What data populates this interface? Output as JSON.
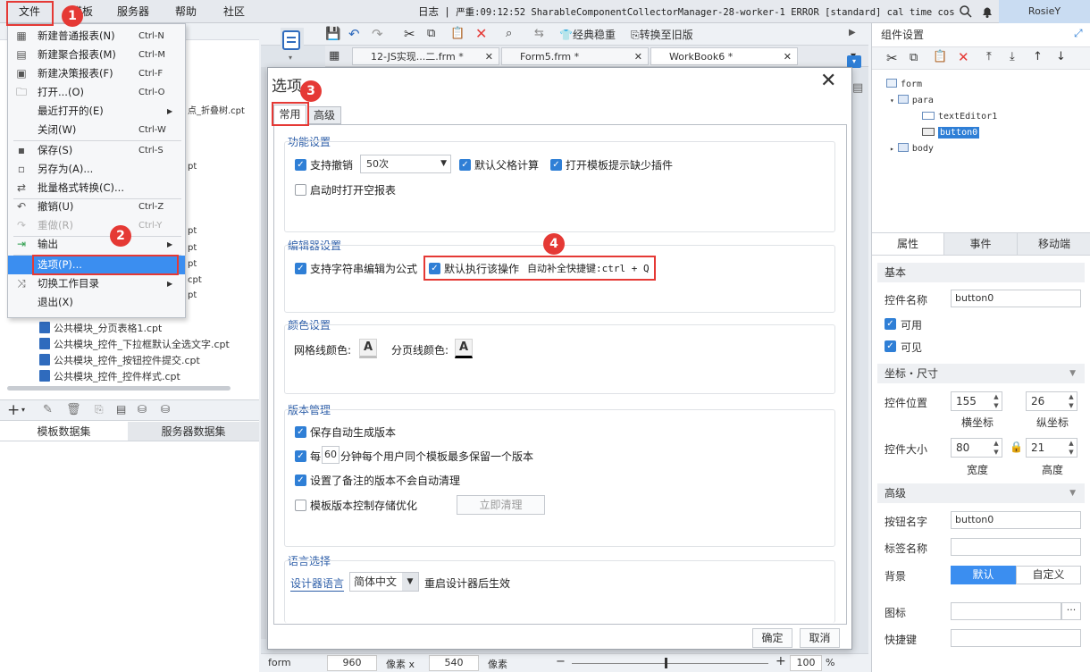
{
  "menubar": {
    "items": [
      "文件",
      "模板",
      "服务器",
      "帮助",
      "社区"
    ],
    "log_label": "日志",
    "log_message": "严重:09:12:52 SharableComponentCollectorManager-28-worker-1 ERROR [standard] cal time cost...",
    "user": "RosieY"
  },
  "file_menu": {
    "items": [
      {
        "icon": "new-report-icon",
        "label": "新建普通报表(N)",
        "shortcut": "Ctrl-N"
      },
      {
        "icon": "new-aggregate-icon",
        "label": "新建聚合报表(M)",
        "shortcut": "Ctrl-M"
      },
      {
        "icon": "new-dashboard-icon",
        "label": "新建决策报表(F)",
        "shortcut": "Ctrl-F"
      },
      {
        "icon": "open-folder-icon",
        "label": "打开...(O)",
        "shortcut": "Ctrl-O"
      },
      {
        "icon": "",
        "label": "最近打开的(E)",
        "shortcut": ""
      },
      {
        "icon": "",
        "label": "关闭(W)",
        "shortcut": "Ctrl-W"
      },
      {
        "icon": "save-icon",
        "label": "保存(S)",
        "shortcut": "Ctrl-S"
      },
      {
        "icon": "save-as-icon",
        "label": "另存为(A)...",
        "shortcut": ""
      },
      {
        "icon": "batch-convert-icon",
        "label": "批量格式转换(C)...",
        "shortcut": ""
      },
      {
        "icon": "undo-icon",
        "label": "撤销(U)",
        "shortcut": "Ctrl-Z"
      },
      {
        "icon": "redo-icon",
        "label": "重做(R)",
        "shortcut": "Ctrl-Y"
      },
      {
        "icon": "export-icon",
        "label": "输出",
        "shortcut": ""
      },
      {
        "icon": "",
        "label": "选项(P)...",
        "shortcut": ""
      },
      {
        "icon": "switch-dir-icon",
        "label": "切换工作目录",
        "shortcut": ""
      },
      {
        "icon": "",
        "label": "退出(X)",
        "shortcut": ""
      }
    ]
  },
  "left_tree": {
    "partial_1": "点_折叠树.cpt",
    "partial_cpt": "pt",
    "partial_cpt2": "cpt",
    "files": [
      "公共模块_分页表格1.cpt",
      "公共模块_控件_下拉框默认全选文字.cpt",
      "公共模块_控件_按钮控件提交.cpt",
      "公共模块_控件_控件样式.cpt"
    ],
    "bottom_tabs": [
      "模板数据集",
      "服务器数据集"
    ]
  },
  "editor": {
    "toolbar_classic": "经典稳重",
    "toolbar_convert": "转换至旧版",
    "tabs": [
      "12-JS实现...二.frm *",
      "Form5.frm *",
      "WorkBook6 *"
    ],
    "status": {
      "name": "form",
      "width": "960",
      "width_unit": "像素 x",
      "height": "540",
      "height_unit": "像素",
      "zoom": "100",
      "zoom_unit": "%"
    }
  },
  "dialog": {
    "title": "选项",
    "tabs": [
      "常用",
      "高级"
    ],
    "sections": {
      "features": "功能设置",
      "editor": "编辑器设置",
      "colors": "颜色设置",
      "version": "版本管理",
      "language": "语言选择"
    },
    "features": {
      "undo": "支持撤销",
      "undo_count": "50次",
      "parent_calc": "默认父格计算",
      "plugin_hint": "打开模板提示缺少插件",
      "open_empty": "启动时打开空报表"
    },
    "editor_settings": {
      "string_formula": "支持字符串编辑为公式",
      "default_action": "默认执行该操作",
      "autocomplete": "自动补全快捷键:ctrl + Q"
    },
    "colors": {
      "grid": "网格线颜色:",
      "page_break": "分页线颜色:"
    },
    "version": {
      "auto_gen": "保存自动生成版本",
      "every": "每",
      "minutes": "60",
      "keep_rule": "分钟每个用户同个模板最多保留一个版本",
      "noted_keep": "设置了备注的版本不会自动清理",
      "storage_opt": "模板版本控制存储优化",
      "clear_now": "立即清理"
    },
    "language": {
      "label": "设计器语言",
      "value": "简体中文",
      "note": "重启设计器后生效"
    },
    "ok": "确定",
    "cancel": "取消"
  },
  "right_panel": {
    "title": "组件设置",
    "tree": [
      "form",
      "para",
      "textEditor1",
      "button0",
      "body"
    ],
    "tabs": [
      "属性",
      "事件",
      "移动端"
    ],
    "basic": "基本",
    "control_name_label": "控件名称",
    "control_name": "button0",
    "enabled": "可用",
    "visible": "可见",
    "coord_size": "坐标・尺寸",
    "position_label": "控件位置",
    "pos_x": "155",
    "pos_y": "26",
    "pos_x_label": "横坐标",
    "pos_y_label": "纵坐标",
    "size_label": "控件大小",
    "width": "80",
    "height": "21",
    "width_label": "宽度",
    "height_label": "高度",
    "advanced": "高级",
    "button_name_label": "按钮名字",
    "button_name": "button0",
    "tag_name_label": "标签名称",
    "background_label": "背景",
    "bg_default": "默认",
    "bg_custom": "自定义",
    "icon_label": "图标",
    "hotkey_label": "快捷键"
  },
  "annotations": [
    "1",
    "2",
    "3",
    "4"
  ],
  "colors": {
    "accent": "#2f7fd6",
    "highlight_red": "#e53935",
    "menu_selected": "#3b8ef0"
  }
}
